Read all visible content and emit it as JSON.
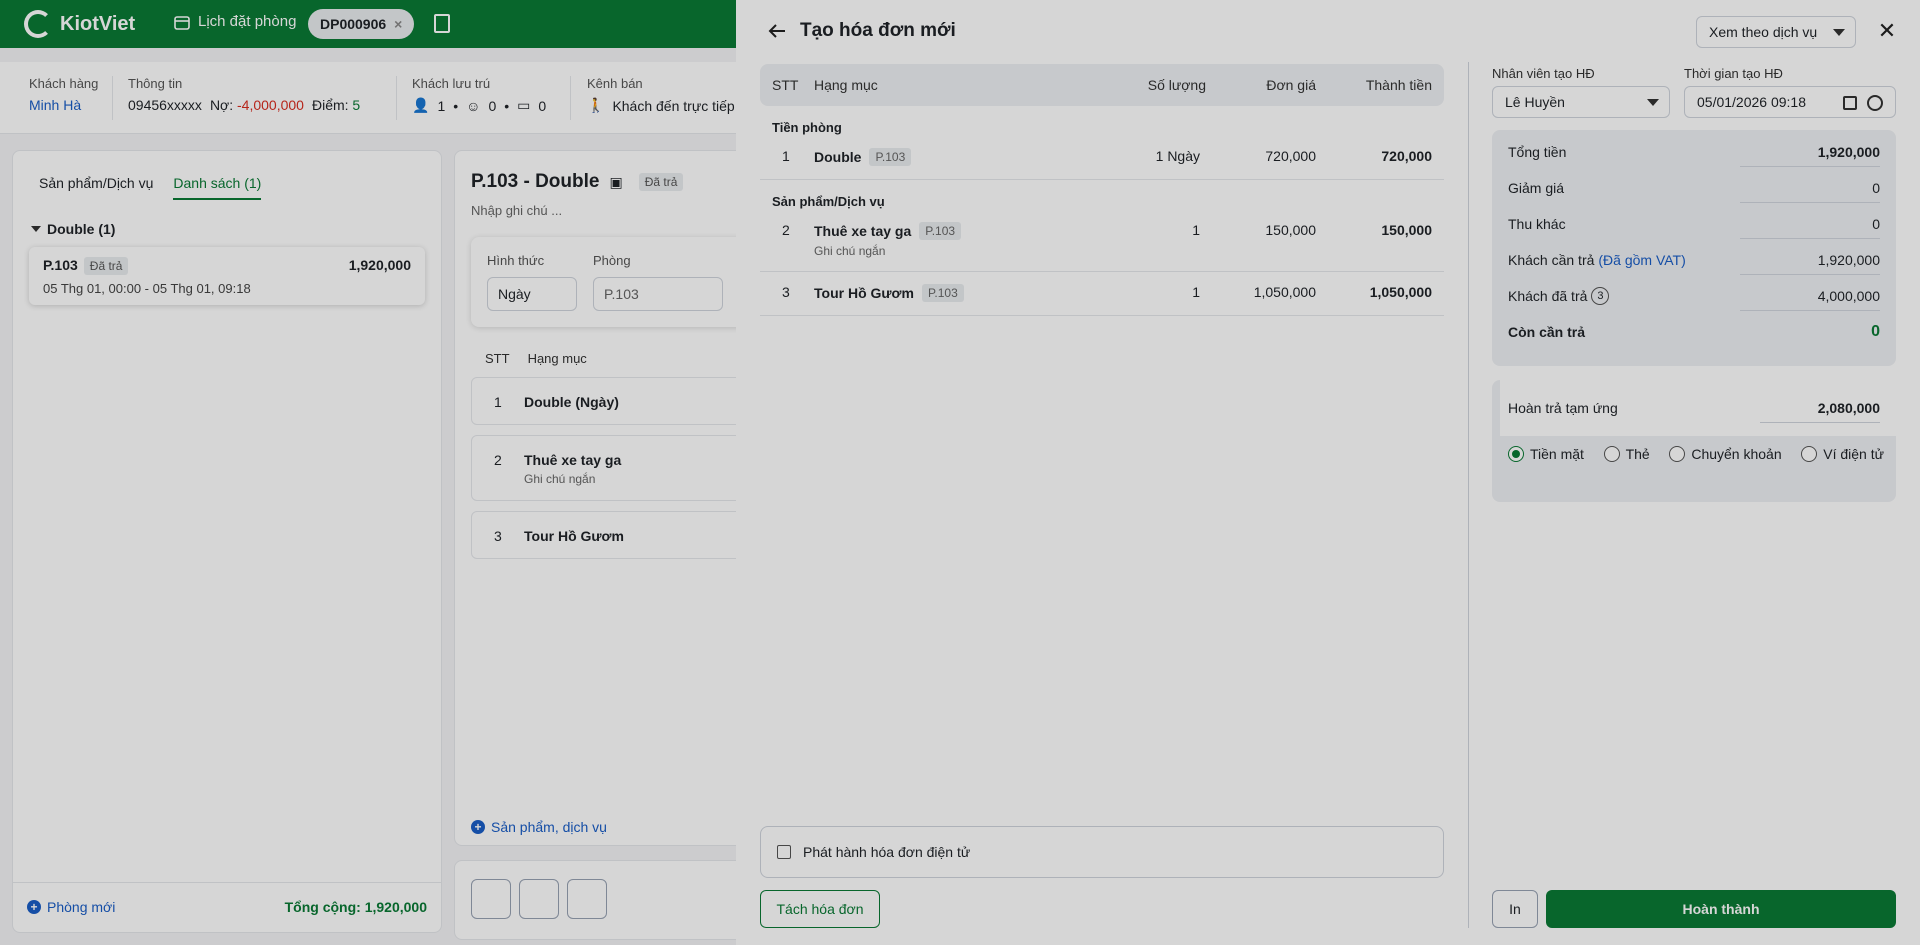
{
  "app": {
    "brand": "KiotViet"
  },
  "topnav": {
    "calendar_label": "Lịch đặt phòng",
    "booking_tab": "DP000906"
  },
  "customer": {
    "label": "Khách hàng",
    "name": "Minh Hà",
    "info_label": "Thông tin",
    "phone": "09456xxxxx",
    "debt_label": "Nợ:",
    "debt_value": "-4,000,000",
    "points_label": "Điểm:",
    "points_value": "5",
    "guests_label": "Khách lưu trú",
    "adults": "1",
    "children": "0",
    "ids": "0",
    "channel_label": "Kênh bán",
    "channel_value": "Khách đến trực tiếp"
  },
  "left_panel": {
    "tabs": [
      "Sản phẩm/Dịch vụ",
      "Danh sách (1)"
    ],
    "group_label": "Double (1)",
    "room": {
      "code": "P.103",
      "status": "Đã trả",
      "amount": "1,920,000",
      "time": "05 Thg 01, 00:00 - 05 Thg 01, 09:18"
    },
    "new_room": "Phòng mới",
    "total": "Tổng cộng: 1,920,000"
  },
  "mid_panel": {
    "title": "P.103 - Double",
    "status": "Đã trả",
    "note_placeholder": "Nhập ghi chú ...",
    "form_label": "Hình thức",
    "form_value": "Ngày",
    "room_label": "Phòng",
    "room_value": "P.103",
    "col_stt": "STT",
    "col_item": "Hạng mục",
    "rows": [
      {
        "n": "1",
        "name": "Double (Ngày)",
        "note": ""
      },
      {
        "n": "2",
        "name": "Thuê xe tay ga",
        "note": "Ghi chú ngắn"
      },
      {
        "n": "3",
        "name": "Tour Hồ Gươm",
        "note": ""
      }
    ],
    "add_label": "Sản phẩm, dịch vụ"
  },
  "drawer": {
    "title": "Tạo hóa đơn mới",
    "view_select": "Xem theo dịch vụ",
    "headers": {
      "stt": "STT",
      "item": "Hạng mục",
      "qty": "Số lượng",
      "price": "Đơn giá",
      "total": "Thành tiền"
    },
    "sections": [
      {
        "title": "Tiền phòng",
        "rows": [
          {
            "stt": "1",
            "name": "Double",
            "tag": "P.103",
            "note": "",
            "qty": "1 Ngày",
            "price": "720,000",
            "total": "720,000"
          }
        ]
      },
      {
        "title": "Sản phẩm/Dịch vụ",
        "rows": [
          {
            "stt": "2",
            "name": "Thuê xe tay ga",
            "tag": "P.103",
            "note": "Ghi chú ngắn",
            "qty": "1",
            "price": "150,000",
            "total": "150,000"
          },
          {
            "stt": "3",
            "name": "Tour Hồ Gươm",
            "tag": "P.103",
            "note": "",
            "qty": "1",
            "price": "1,050,000",
            "total": "1,050,000"
          }
        ]
      }
    ],
    "einvoice_label": "Phát hành hóa đơn điện tử",
    "split_button": "Tách hóa đơn",
    "staff_label": "Nhân viên tạo HĐ",
    "staff_value": "Lê Huyền",
    "time_label": "Thời gian tạo HĐ",
    "time_value": "05/01/2026 09:18",
    "summary": {
      "total_label": "Tổng tiền",
      "total_value": "1,920,000",
      "discount_label": "Giảm giá",
      "discount_value": "0",
      "other_label": "Thu khác",
      "other_value": "0",
      "due_label": "Khách cần trả",
      "due_vat": "(Đã gồm VAT)",
      "due_value": "1,920,000",
      "paid_label": "Khách đã trả",
      "paid_count": "3",
      "paid_value": "4,000,000",
      "remain_label": "Còn cần trả",
      "remain_value": "0"
    },
    "refund_label": "Hoàn trả tạm ứng",
    "refund_value": "2,080,000",
    "payment_methods": [
      "Tiền mặt",
      "Thẻ",
      "Chuyển khoản",
      "Ví điện tử"
    ],
    "print_button": "In",
    "done_button": "Hoàn thành"
  }
}
